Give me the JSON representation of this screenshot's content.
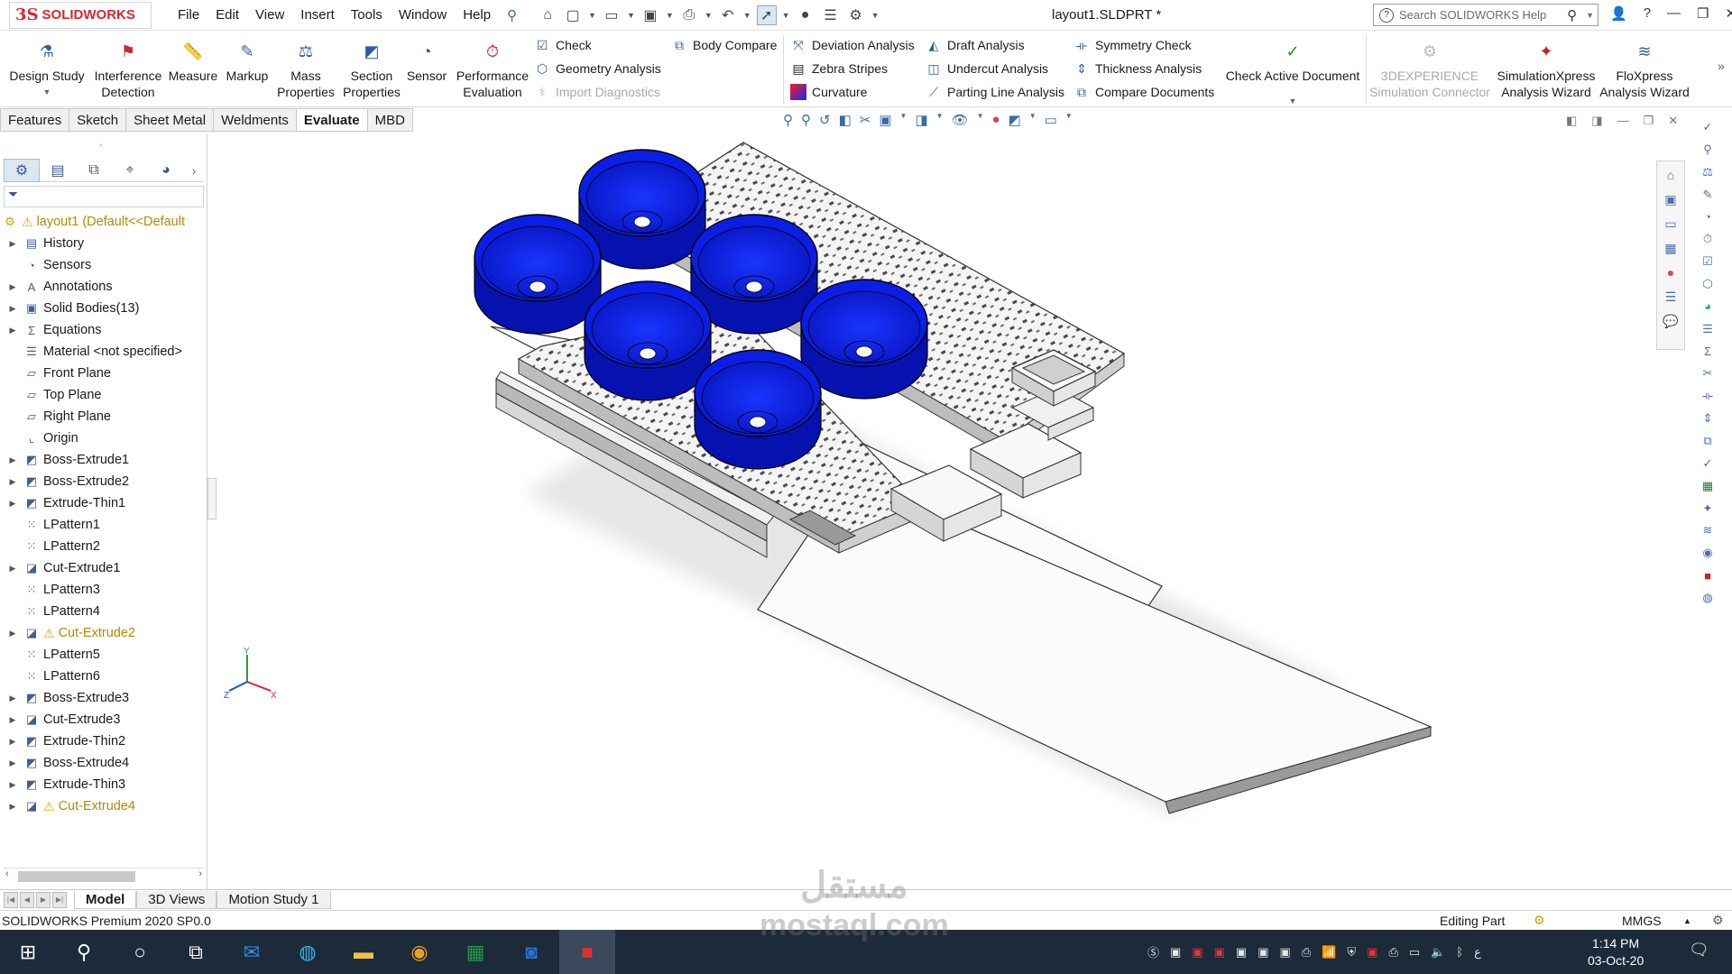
{
  "app": {
    "brand_prefix": "3S",
    "brand_name": "SOLIDWORKS",
    "document_title": "layout1.SLDPRT *"
  },
  "menus": [
    "File",
    "Edit",
    "View",
    "Insert",
    "Tools",
    "Window",
    "Help"
  ],
  "search": {
    "placeholder": "Search SOLIDWORKS Help"
  },
  "ribbon": {
    "design_study": "Design Study",
    "interference_detection_1": "Interference",
    "interference_detection_2": "Detection",
    "measure": "Measure",
    "markup": "Markup",
    "mass_properties_1": "Mass",
    "mass_properties_2": "Properties",
    "section_properties_1": "Section",
    "section_properties_2": "Properties",
    "sensor": "Sensor",
    "performance_evaluation_1": "Performance",
    "performance_evaluation_2": "Evaluation",
    "check": "Check",
    "geometry_analysis": "Geometry Analysis",
    "import_diagnostics": "Import Diagnostics",
    "body_compare": "Body Compare",
    "deviation_analysis": "Deviation Analysis",
    "zebra_stripes": "Zebra Stripes",
    "curvature": "Curvature",
    "draft_analysis": "Draft Analysis",
    "undercut_analysis": "Undercut Analysis",
    "parting_line_analysis": "Parting Line Analysis",
    "symmetry_check": "Symmetry Check",
    "thickness_analysis": "Thickness Analysis",
    "compare_documents": "Compare Documents",
    "check_active_document": "Check Active Document",
    "experience_connector_1": "3DEXPERIENCE",
    "experience_connector_2": "Simulation Connector",
    "simxpress_1": "SimulationXpress",
    "simxpress_2": "Analysis Wizard",
    "floxpress_1": "FloXpress",
    "floxpress_2": "Analysis Wizard"
  },
  "command_tabs": [
    "Features",
    "Sketch",
    "Sheet Metal",
    "Weldments",
    "Evaluate",
    "MBD"
  ],
  "active_command_tab": "Evaluate",
  "tree": {
    "root": "layout1  (Default<<Default",
    "items": [
      {
        "label": "History",
        "icon": "history-icon",
        "expand": true
      },
      {
        "label": "Sensors",
        "icon": "sensor-icon",
        "expand": false
      },
      {
        "label": "Annotations",
        "icon": "annotations-icon",
        "expand": true
      },
      {
        "label": "Solid Bodies(13)",
        "icon": "solid-bodies-icon",
        "expand": true
      },
      {
        "label": "Equations",
        "icon": "equations-icon",
        "expand": true
      },
      {
        "label": "Material <not specified>",
        "icon": "material-icon",
        "expand": false
      },
      {
        "label": "Front Plane",
        "icon": "plane-icon",
        "expand": false
      },
      {
        "label": "Top Plane",
        "icon": "plane-icon",
        "expand": false
      },
      {
        "label": "Right Plane",
        "icon": "plane-icon",
        "expand": false
      },
      {
        "label": "Origin",
        "icon": "origin-icon",
        "expand": false
      },
      {
        "label": "Boss-Extrude1",
        "icon": "extrude-icon",
        "expand": true
      },
      {
        "label": "Boss-Extrude2",
        "icon": "extrude-icon",
        "expand": true
      },
      {
        "label": "Extrude-Thin1",
        "icon": "extrude-icon",
        "expand": true
      },
      {
        "label": "LPattern1",
        "icon": "pattern-icon",
        "expand": false
      },
      {
        "label": "LPattern2",
        "icon": "pattern-icon",
        "expand": false
      },
      {
        "label": "Cut-Extrude1",
        "icon": "cut-icon",
        "expand": true
      },
      {
        "label": "LPattern3",
        "icon": "pattern-icon",
        "expand": false
      },
      {
        "label": "LPattern4",
        "icon": "pattern-icon",
        "expand": false
      },
      {
        "label": "Cut-Extrude2",
        "icon": "cut-icon",
        "expand": true,
        "warning": true
      },
      {
        "label": "LPattern5",
        "icon": "pattern-icon",
        "expand": false
      },
      {
        "label": "LPattern6",
        "icon": "pattern-icon",
        "expand": false
      },
      {
        "label": "Boss-Extrude3",
        "icon": "extrude-icon",
        "expand": true
      },
      {
        "label": "Cut-Extrude3",
        "icon": "cut-icon",
        "expand": true
      },
      {
        "label": "Extrude-Thin2",
        "icon": "extrude-icon",
        "expand": true
      },
      {
        "label": "Boss-Extrude4",
        "icon": "extrude-icon",
        "expand": true
      },
      {
        "label": "Extrude-Thin3",
        "icon": "extrude-icon",
        "expand": true
      },
      {
        "label": "Cut-Extrude4",
        "icon": "cut-icon",
        "expand": true,
        "warning": true
      }
    ]
  },
  "bottom_tabs": [
    "Model",
    "3D Views",
    "Motion Study 1"
  ],
  "active_bottom_tab": "Model",
  "status": {
    "product": "SOLIDWORKS Premium 2020 SP0.0",
    "mode": "Editing Part",
    "units": "MMGS"
  },
  "taskbar": {
    "time": "1:14 PM",
    "date": "03-Oct-20"
  },
  "triad_labels": {
    "x": "X",
    "y": "Y",
    "z": "Z"
  },
  "watermark": {
    "line1": "مستقل",
    "line2": "mostaql.com"
  },
  "colors": {
    "brand_red": "#d8262f",
    "cup_blue": "#0a1ee6",
    "accent_blue": "#2b78c6"
  }
}
